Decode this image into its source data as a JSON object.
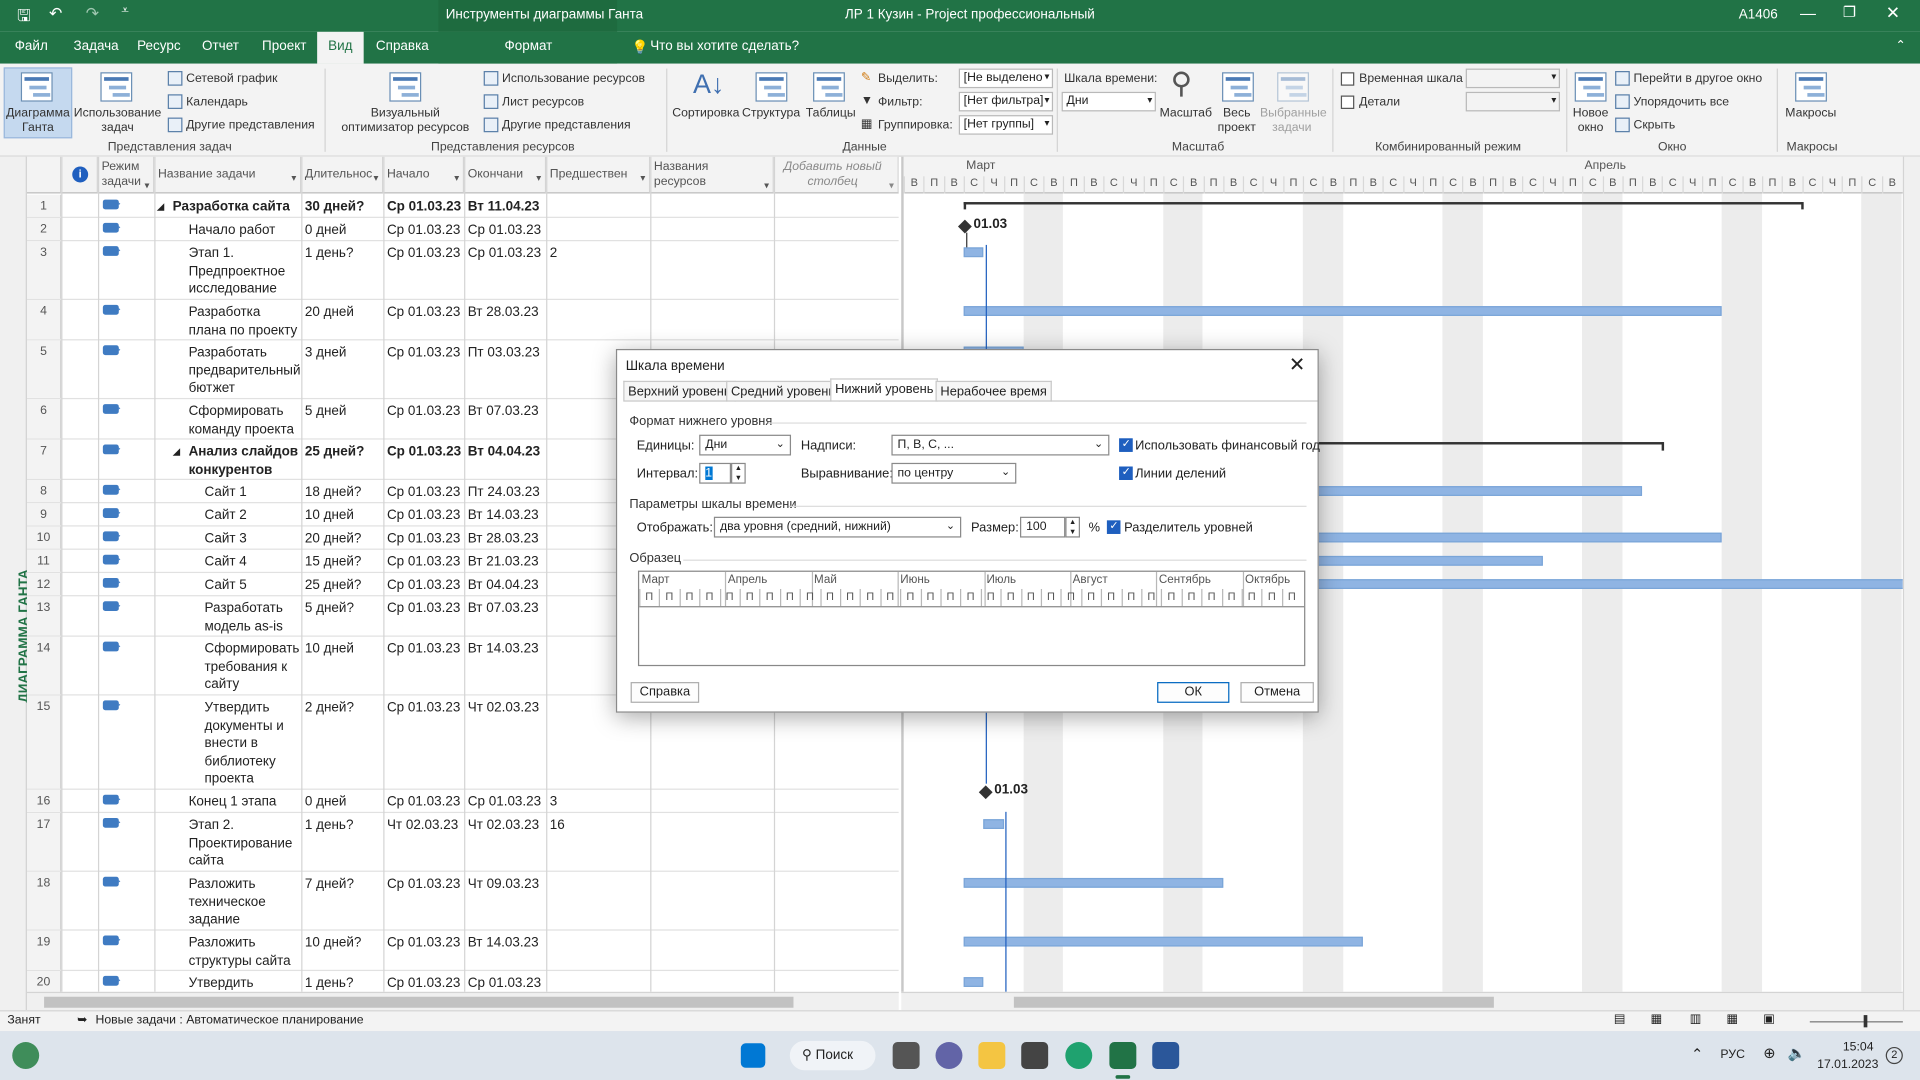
{
  "titlebar": {
    "context_tools": "Инструменты диаграммы Ганта",
    "doc_title": "ЛР 1 Кузин  -  Project профессиональный",
    "user": "A1406"
  },
  "tabs": [
    "Файл",
    "Задача",
    "Ресурс",
    "Отчет",
    "Проект",
    "Вид",
    "Справка",
    "Формат"
  ],
  "tell_me": "Что вы хотите сделать?",
  "ribbon": {
    "gantt_chart": "Диаграмма Ганта",
    "task_usage": "Использование задач",
    "network": "Сетевой график",
    "calendar": "Календарь",
    "other_views": "Другие представления",
    "grp_task_views": "Представления задач",
    "team_planner": "Визуальный оптимизатор ресурсов",
    "resource_usage": "Использование ресурсов",
    "resource_sheet": "Лист ресурсов",
    "other_views2": "Другие представления",
    "grp_resource_views": "Представления ресурсов",
    "sort": "Сортировка",
    "outline": "Структура",
    "tables": "Таблицы",
    "highlight": "Выделить:",
    "filter": "Фильтр:",
    "group": "Группировка:",
    "highlight_val": "[Не выделено",
    "filter_val": "[Нет фильтра]",
    "group_val": "[Нет группы]",
    "grp_data": "Данные",
    "timescale": "Шкала времени:",
    "timescale_val": "Дни",
    "zoom": "Масштаб",
    "entire_project": "Весь проект",
    "selected_tasks": "Выбранные задачи",
    "grp_zoom": "Масштаб",
    "timeline": "Временная шкала",
    "details": "Детали",
    "grp_split": "Комбинированный режим",
    "new_window": "Новое окно",
    "switch_windows": "Перейти в другое окно",
    "arrange_all": "Упорядочить все",
    "hide": "Скрыть",
    "grp_window": "Окно",
    "macros": "Макросы",
    "grp_macros": "Макросы"
  },
  "viewbar_label": "ДИАГРАММА ГАНТА",
  "table": {
    "headers": [
      "Режим задачи",
      "Название задачи",
      "Длительнос",
      "Начало",
      "Окончани",
      "Предшествен",
      "Названия ресурсов",
      "Добавить новый столбец"
    ],
    "rows": [
      {
        "n": "1",
        "name": "Разработка сайта",
        "dur": "30 дней?",
        "start": "Ср 01.03.23",
        "end": "Вт 11.04.23",
        "pred": "",
        "bold": true
      },
      {
        "n": "2",
        "name": "Начало работ",
        "dur": "0 дней",
        "start": "Ср 01.03.23",
        "end": "Ср 01.03.23",
        "pred": ""
      },
      {
        "n": "3",
        "name": "Этап 1.\nПредпроектное\nисследование",
        "dur": "1 день?",
        "start": "Ср 01.03.23",
        "end": "Ср 01.03.23",
        "pred": "2"
      },
      {
        "n": "4",
        "name": "Разработка\nплана по проекту",
        "dur": "20 дней",
        "start": "Ср 01.03.23",
        "end": "Вт 28.03.23",
        "pred": ""
      },
      {
        "n": "5",
        "name": "Разработать\nпредварительный\nбютжет",
        "dur": "3 дней",
        "start": "Ср 01.03.23",
        "end": "Пт 03.03.23",
        "pred": ""
      },
      {
        "n": "6",
        "name": "Сформировать\nкоманду проекта",
        "dur": "5 дней",
        "start": "Ср 01.03.23",
        "end": "Вт 07.03.23",
        "pred": ""
      },
      {
        "n": "7",
        "name": "Анализ слайдов\nконкурентов",
        "dur": "25 дней?",
        "start": "Ср 01.03.23",
        "end": "Вт 04.04.23",
        "pred": "",
        "bold": true
      },
      {
        "n": "8",
        "name": "Сайт 1",
        "dur": "18 дней?",
        "start": "Ср 01.03.23",
        "end": "Пт 24.03.23",
        "pred": ""
      },
      {
        "n": "9",
        "name": "Сайт 2",
        "dur": "10 дней",
        "start": "Ср 01.03.23",
        "end": "Вт 14.03.23",
        "pred": ""
      },
      {
        "n": "10",
        "name": "Сайт 3",
        "dur": "20 дней?",
        "start": "Ср 01.03.23",
        "end": "Вт 28.03.23",
        "pred": ""
      },
      {
        "n": "11",
        "name": "Сайт 4",
        "dur": "15 дней?",
        "start": "Ср 01.03.23",
        "end": "Вт 21.03.23",
        "pred": ""
      },
      {
        "n": "12",
        "name": "Сайт 5",
        "dur": "25 дней?",
        "start": "Ср 01.03.23",
        "end": "Вт 04.04.23",
        "pred": ""
      },
      {
        "n": "13",
        "name": "Разработать\nмодель as-is",
        "dur": "5 дней?",
        "start": "Ср 01.03.23",
        "end": "Вт 07.03.23",
        "pred": ""
      },
      {
        "n": "14",
        "name": "Сформировать\nтребования к\nсайту",
        "dur": "10 дней",
        "start": "Ср 01.03.23",
        "end": "Вт 14.03.23",
        "pred": ""
      },
      {
        "n": "15",
        "name": "Утвердить\nдокументы и\nвнести в\nбиблиотеку\nпроекта",
        "dur": "2 дней?",
        "start": "Ср 01.03.23",
        "end": "Чт 02.03.23",
        "pred": ""
      },
      {
        "n": "16",
        "name": "Конец 1 этапа",
        "dur": "0 дней",
        "start": "Ср 01.03.23",
        "end": "Ср 01.03.23",
        "pred": "3"
      },
      {
        "n": "17",
        "name": "Этап 2.\nПроектирование\nсайта",
        "dur": "1 день?",
        "start": "Чт 02.03.23",
        "end": "Чт 02.03.23",
        "pred": "16"
      },
      {
        "n": "18",
        "name": "Разложить\nтехническое\nзадание",
        "dur": "7 дней?",
        "start": "Ср 01.03.23",
        "end": "Чт 09.03.23",
        "pred": ""
      },
      {
        "n": "19",
        "name": "Разложить\nструктуры сайта",
        "dur": "10 дней?",
        "start": "Ср 01.03.23",
        "end": "Вт 14.03.23",
        "pred": ""
      },
      {
        "n": "20",
        "name": "Утвердить\nдокументы и",
        "dur": "1 день?",
        "start": "Ср 01.03.23",
        "end": "Ср 01.03.23",
        "pred": ""
      }
    ]
  },
  "gantt": {
    "months": [
      "Март",
      "Апрель"
    ],
    "day_letters": [
      "В",
      "П",
      "В",
      "С",
      "Ч",
      "П",
      "С",
      "В",
      "П",
      "В",
      "С",
      "Ч",
      "П",
      "С",
      "В",
      "П",
      "В",
      "С",
      "Ч",
      "П",
      "С",
      "В",
      "П",
      "В",
      "С",
      "Ч",
      "П",
      "С",
      "В",
      "П",
      "В",
      "С",
      "Ч",
      "П",
      "С",
      "В",
      "П",
      "В",
      "С",
      "Ч",
      "П",
      "С",
      "В",
      "П",
      "В",
      "С",
      "Ч",
      "П",
      "С",
      "В"
    ],
    "milestone1": "01.03",
    "milestone2": "01.03",
    "bars": [
      {
        "row": 3,
        "start": 0,
        "days": 1
      },
      {
        "row": 4,
        "start": 0,
        "days": 28
      },
      {
        "row": 5,
        "start": 0,
        "days": 3
      },
      {
        "row": 8,
        "start": 0,
        "days": 24
      },
      {
        "row": 10,
        "start": 0,
        "days": 28
      },
      {
        "row": 11,
        "start": 0,
        "days": 21
      },
      {
        "row": 12,
        "start": 0,
        "days": 35
      },
      {
        "row": 17,
        "start": 1,
        "days": 1
      },
      {
        "row": 18,
        "start": 0,
        "days": 9
      },
      {
        "row": 19,
        "start": 0,
        "days": 14
      },
      {
        "row": 20,
        "start": 0,
        "days": 1
      }
    ]
  },
  "status": {
    "state": "Занят",
    "new_tasks": "Новые задачи : Автоматическое планирование"
  },
  "taskbar": {
    "search": "Поиск",
    "lang": "РУС",
    "time": "15:04",
    "date": "17.01.2023",
    "badge": "2"
  },
  "dialog": {
    "title": "Шкала времени",
    "tabs": [
      "Верхний уровень",
      "Средний уровень",
      "Нижний уровень",
      "Нерабочее время"
    ],
    "section_format": "Формат нижнего уровня",
    "units_label": "Единицы:",
    "units_val": "Дни",
    "labels_label": "Надписи:",
    "labels_val": "П, В, С, ...",
    "fiscal_year": "Использовать финансовый год",
    "interval_label": "Интервал:",
    "interval_val": "1",
    "align_label": "Выравнивание:",
    "align_val": "по центру",
    "tick_lines": "Линии делений",
    "section_options": "Параметры шкалы времени",
    "show_label": "Отображать:",
    "show_val": "два уровня (средний, нижний)",
    "size_label": "Размер:",
    "size_val": "100",
    "percent": "%",
    "separator": "Разделитель уровней",
    "sample_label": "Образец",
    "sample_months": [
      "Март",
      "Апрель",
      "Май",
      "Июнь",
      "Июль",
      "Август",
      "Сентябрь",
      "Октябрь"
    ],
    "help_btn": "Справка",
    "ok_btn": "ОК",
    "cancel_btn": "Отмена"
  }
}
